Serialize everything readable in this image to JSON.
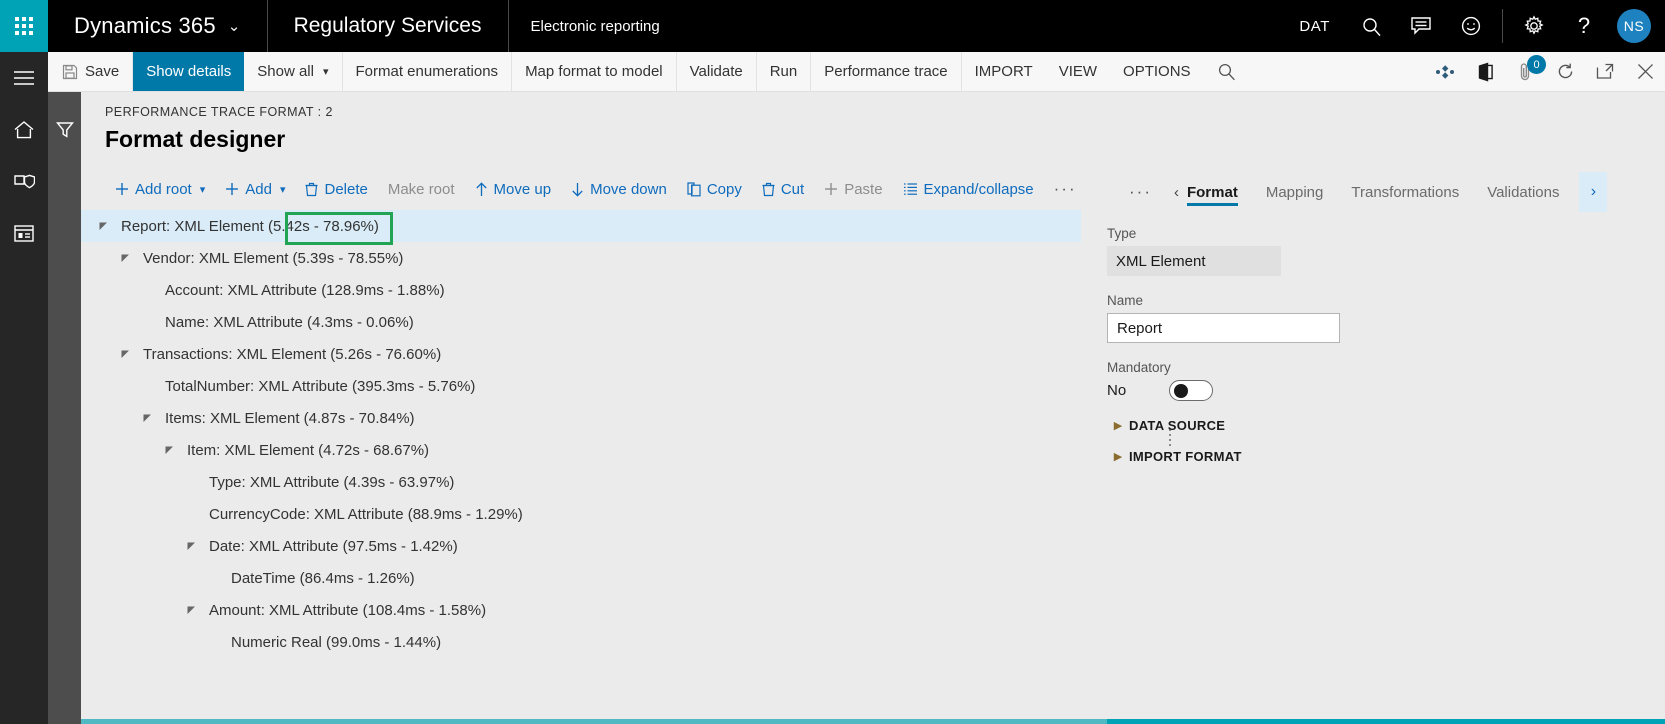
{
  "topnav": {
    "waffle_icon": "app-launcher-icon",
    "brand": "Dynamics 365",
    "brand_caret": "⌄",
    "area": "Regulatory Services",
    "page": "Electronic reporting",
    "company": "DAT",
    "icons": [
      "search-icon",
      "message-icon",
      "feedback-smiley-icon",
      "gear-icon",
      "help-icon"
    ],
    "avatar_initials": "NS"
  },
  "rail": {
    "items": [
      "hamburger-menu-icon",
      "home-icon",
      "favorites-shield-icon",
      "workspaces-icon"
    ],
    "filter_icon": "filter-icon"
  },
  "toolbar": {
    "save": "Save",
    "show_details": "Show details",
    "show_all": "Show all",
    "format_enumerations": "Format enumerations",
    "map_format_to_model": "Map format to model",
    "validate": "Validate",
    "run": "Run",
    "performance_trace": "Performance trace",
    "import": "IMPORT",
    "view": "VIEW",
    "options": "OPTIONS",
    "search_icon": "search-icon",
    "right_icons": [
      "personalize-icon",
      "open-in-office-icon",
      "attachments-icon",
      "refresh-icon",
      "popout-icon",
      "close-icon"
    ],
    "attachment_badge": "0"
  },
  "page": {
    "caption": "PERFORMANCE TRACE FORMAT : 2",
    "title": "Format designer"
  },
  "treebar": {
    "add_root": "Add root",
    "add": "Add",
    "delete": "Delete",
    "make_root": "Make root",
    "move_up": "Move up",
    "move_down": "Move down",
    "copy": "Copy",
    "cut": "Cut",
    "paste": "Paste",
    "expand_collapse": "Expand/collapse",
    "overflow": "···"
  },
  "tree": {
    "rows": [
      {
        "label": "Report: XML Element (5.42s - 78.96%)",
        "indent": 0,
        "expander": "expanded",
        "selected": true
      },
      {
        "label": "Vendor: XML Element (5.39s - 78.55%)",
        "indent": 1,
        "expander": "expanded",
        "selected": false
      },
      {
        "label": "Account: XML Attribute (128.9ms - 1.88%)",
        "indent": 2,
        "expander": "none",
        "selected": false
      },
      {
        "label": "Name: XML Attribute (4.3ms - 0.06%)",
        "indent": 2,
        "expander": "none",
        "selected": false
      },
      {
        "label": "Transactions: XML Element (5.26s - 76.60%)",
        "indent": 1,
        "expander": "expanded",
        "selected": false
      },
      {
        "label": "TotalNumber: XML Attribute (395.3ms - 5.76%)",
        "indent": 2,
        "expander": "none",
        "selected": false
      },
      {
        "label": "Items: XML Element (4.87s - 70.84%)",
        "indent": 2,
        "expander": "expanded",
        "selected": false
      },
      {
        "label": "Item: XML Element (4.72s - 68.67%)",
        "indent": 3,
        "expander": "expanded",
        "selected": false
      },
      {
        "label": "Type: XML Attribute (4.39s - 63.97%)",
        "indent": 4,
        "expander": "none",
        "selected": false
      },
      {
        "label": "CurrencyCode: XML Attribute (88.9ms - 1.29%)",
        "indent": 4,
        "expander": "none",
        "selected": false
      },
      {
        "label": "Date: XML Attribute (97.5ms - 1.42%)",
        "indent": 4,
        "expander": "expanded",
        "selected": false
      },
      {
        "label": "DateTime (86.4ms - 1.26%)",
        "indent": 5,
        "expander": "none",
        "selected": false
      },
      {
        "label": "Amount: XML Attribute (108.4ms - 1.58%)",
        "indent": 4,
        "expander": "expanded",
        "selected": false
      },
      {
        "label": "Numeric Real (99.0ms - 1.44%)",
        "indent": 5,
        "expander": "none",
        "selected": false
      }
    ],
    "annotation_color": "#23a455"
  },
  "rpanel": {
    "overflow": "···",
    "prev_arrow": "‹",
    "next_arrow": "›",
    "tabs": [
      {
        "label": "Format",
        "active": true
      },
      {
        "label": "Mapping",
        "active": false
      },
      {
        "label": "Transformations",
        "active": false
      },
      {
        "label": "Validations",
        "active": false
      }
    ],
    "type_label": "Type",
    "type_value": "XML Element",
    "name_label": "Name",
    "name_value": "Report",
    "mandatory_label": "Mandatory",
    "mandatory_value": "No",
    "sections": [
      "DATA SOURCE",
      "IMPORT FORMAT"
    ]
  },
  "colors": {
    "accent_teal": "#00a2b5",
    "accent_blue": "#0078a8",
    "link_blue": "#0f6cbd",
    "annotation_green": "#23a455",
    "selection_blue": "#d9ecf8"
  }
}
